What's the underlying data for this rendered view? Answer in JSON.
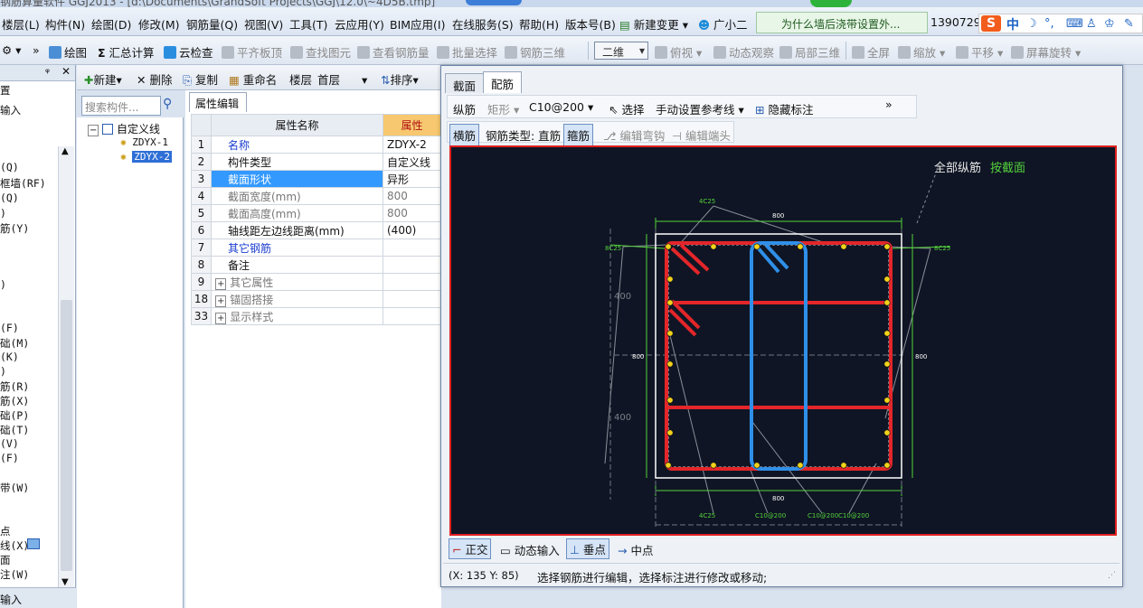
{
  "app": {
    "title": "钢筋算量软件 GGJ2013 - [d:\\Documents\\GrandSoft Projects\\GGJ\\12.0\\~4D5B.tmp]"
  },
  "menu": {
    "items": [
      "楼层(L)",
      "构件(N)",
      "绘图(D)",
      "修改(M)",
      "钢筋量(Q)",
      "视图(V)",
      "工具(T)",
      "云应用(Y)",
      "BIM应用(I)",
      "在线服务(S)",
      "帮助(H)",
      "版本号(B)"
    ],
    "new_change": "新建变更",
    "assistant": "广小二",
    "qa_text": "为什么墙后浇带设置外...",
    "phone": "1390729"
  },
  "ime": {
    "zh": "中"
  },
  "toolbar": {
    "draw": "绘图",
    "sum_calc": "汇总计算",
    "cloud_check": "云检查",
    "flush_slab": "平齐板顶",
    "find_element": "查找图元",
    "view_rebar": "查看钢筋量",
    "batch_select": "批量选择",
    "rebar_3d": "钢筋三维",
    "view_mode": "二维",
    "top_view": "俯视",
    "dynamic_observe": "动态观察",
    "local_3d": "局部三维",
    "fullscreen": "全屏",
    "zoom": "缩放",
    "pan": "平移",
    "rotate": "屏幕旋转"
  },
  "left_panel": {
    "items": [
      "置",
      "输入",
      "(Q)",
      "框墙(RF)",
      "(Q)",
      ")",
      "筋(Y)",
      ")",
      "(F)",
      "础(M)",
      "(K)",
      ")",
      "筋(R)",
      "筋(X)",
      "础(P)",
      "础(T)",
      "(V)",
      "(F)",
      "带(W)",
      "点",
      "线(X)",
      "面",
      "注(W)"
    ],
    "bottom": "输入"
  },
  "component_bar": {
    "new": "新建",
    "delete": "删除",
    "copy": "复制",
    "rename": "重命名",
    "floor_label": "楼层",
    "floor_value": "首层",
    "sort": "排序"
  },
  "search": {
    "placeholder": "搜索构件..."
  },
  "tree": {
    "root": "自定义线",
    "children": [
      "ZDYX-1",
      "ZDYX-2"
    ]
  },
  "props": {
    "tab": "属性编辑",
    "header_name": "属性名称",
    "header_value": "属性",
    "rows": [
      {
        "num": "1",
        "name": "名称",
        "value": "ZDYX-2"
      },
      {
        "num": "2",
        "name": "构件类型",
        "value": "自定义线"
      },
      {
        "num": "3",
        "name": "截面形状",
        "value": "异形"
      },
      {
        "num": "4",
        "name": "截面宽度(mm)",
        "value": "800"
      },
      {
        "num": "5",
        "name": "截面高度(mm)",
        "value": "800"
      },
      {
        "num": "6",
        "name": "轴线距左边线距离(mm)",
        "value": "(400)"
      },
      {
        "num": "7",
        "name": "其它钢筋",
        "value": ""
      },
      {
        "num": "8",
        "name": "备注",
        "value": ""
      },
      {
        "num": "9",
        "name": "其它属性",
        "value": ""
      },
      {
        "num": "18",
        "name": "锚固搭接",
        "value": ""
      },
      {
        "num": "33",
        "name": "显示样式",
        "value": ""
      }
    ]
  },
  "dialog": {
    "tab_section": "截面",
    "tab_rebar": "配筋",
    "longitudinal": "纵筋",
    "shape": "矩形",
    "spec": "C10@200",
    "select": "选择",
    "manual_ref": "手动设置参考线",
    "hide_mark": "隐藏标注",
    "transverse": "横筋",
    "rebar_type_label": "钢筋类型: 直筋",
    "stirrup": "箍筋",
    "edit_hook": "编辑弯钩",
    "edit_end": "编辑端头",
    "canvas": {
      "all_long": "全部纵筋",
      "by_section": "按截面",
      "dim_800": "800",
      "dim_400": "400",
      "label_4c25": "4C25",
      "label_8c25": "8C25",
      "label_c10": "C10@200"
    },
    "bottom": {
      "ortho": "正交",
      "dynamic_input": "动态输入",
      "perpendicular": "垂点",
      "midpoint": "中点"
    },
    "status_coord": "(X: 135 Y: 85)",
    "status_msg": "选择钢筋进行编辑，选择标注进行修改或移动;"
  },
  "colors": {
    "rebar_red": "#e3262a",
    "stirrup_blue": "#2f8fe8",
    "dim_green": "#55d23c",
    "canvas_bg": "#0f1524"
  }
}
